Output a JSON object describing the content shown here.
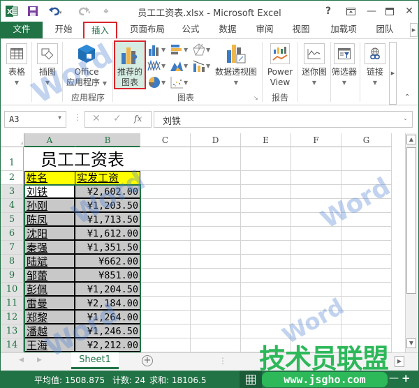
{
  "app": {
    "title": "员工工资表.xlsx - Microsoft Excel",
    "window_controls": {
      "help": "?",
      "ribbon_display": "⊡",
      "minimize": "—",
      "maximize": "☐",
      "close": "✕"
    }
  },
  "quick_access": {
    "excel_icon": "X",
    "save": "save-icon",
    "undo": "undo-icon",
    "redo": "redo-icon",
    "customize": "customize-icon"
  },
  "tabs": [
    {
      "label": "文件"
    },
    {
      "label": "开始"
    },
    {
      "label": "插入"
    },
    {
      "label": "页面布局"
    },
    {
      "label": "公式"
    },
    {
      "label": "数据"
    },
    {
      "label": "审阅"
    },
    {
      "label": "视图"
    },
    {
      "label": "加载项"
    },
    {
      "label": "团队"
    }
  ],
  "ribbon": {
    "table": "表格",
    "illustrations": "插图",
    "office_apps_line1": "Office",
    "office_apps_line2": "应用程序",
    "apps_group": "应用程序",
    "recommended_charts_line1": "推荐的",
    "recommended_charts_line2": "图表",
    "charts_group": "图表",
    "pivot_chart": "数据透视图",
    "power_view_line1": "Power",
    "power_view_line2": "View",
    "reports_group": "报告",
    "sparklines": "迷你图",
    "filters": "筛选器",
    "links": "链接"
  },
  "formula_bar": {
    "name_box": "A3",
    "cancel": "✕",
    "enter": "✓",
    "fx": "fx",
    "content": "刘铁"
  },
  "columns": [
    "A",
    "B",
    "C",
    "D",
    "E",
    "F",
    "G"
  ],
  "sheet": {
    "title": "员工工资表",
    "headers": {
      "name": "姓名",
      "salary": "实发工资"
    },
    "rows": [
      {
        "row": "3",
        "name": "刘铁",
        "salary": "¥2,602.00"
      },
      {
        "row": "4",
        "name": "孙刚",
        "salary": "¥1,203.50"
      },
      {
        "row": "5",
        "name": "陈凤",
        "salary": "¥1,713.50"
      },
      {
        "row": "6",
        "name": "沈阳",
        "salary": "¥1,612.00"
      },
      {
        "row": "7",
        "name": "秦强",
        "salary": "¥1,351.50"
      },
      {
        "row": "8",
        "name": "陆斌",
        "salary": "¥662.00"
      },
      {
        "row": "9",
        "name": "邹蕾",
        "salary": "¥851.00"
      },
      {
        "row": "10",
        "name": "彭佩",
        "salary": "¥1,204.50"
      },
      {
        "row": "11",
        "name": "雷曼",
        "salary": "¥2,184.00"
      },
      {
        "row": "12",
        "name": "郑黎",
        "salary": "¥1,264.00"
      },
      {
        "row": "13",
        "name": "潘越",
        "salary": "¥1,246.50"
      },
      {
        "row": "14",
        "name": "王海",
        "salary": "¥2,212.00"
      }
    ]
  },
  "sheet_tabs": [
    {
      "label": "Sheet1"
    }
  ],
  "add_sheet": "+",
  "status": {
    "average": "平均值: 1508.875",
    "count": "计数: 24",
    "sum": "求和: 18106.5"
  },
  "watermarks": {
    "word": "Word",
    "brand": "技术员联盟",
    "url": "www.jsgho.com"
  }
}
